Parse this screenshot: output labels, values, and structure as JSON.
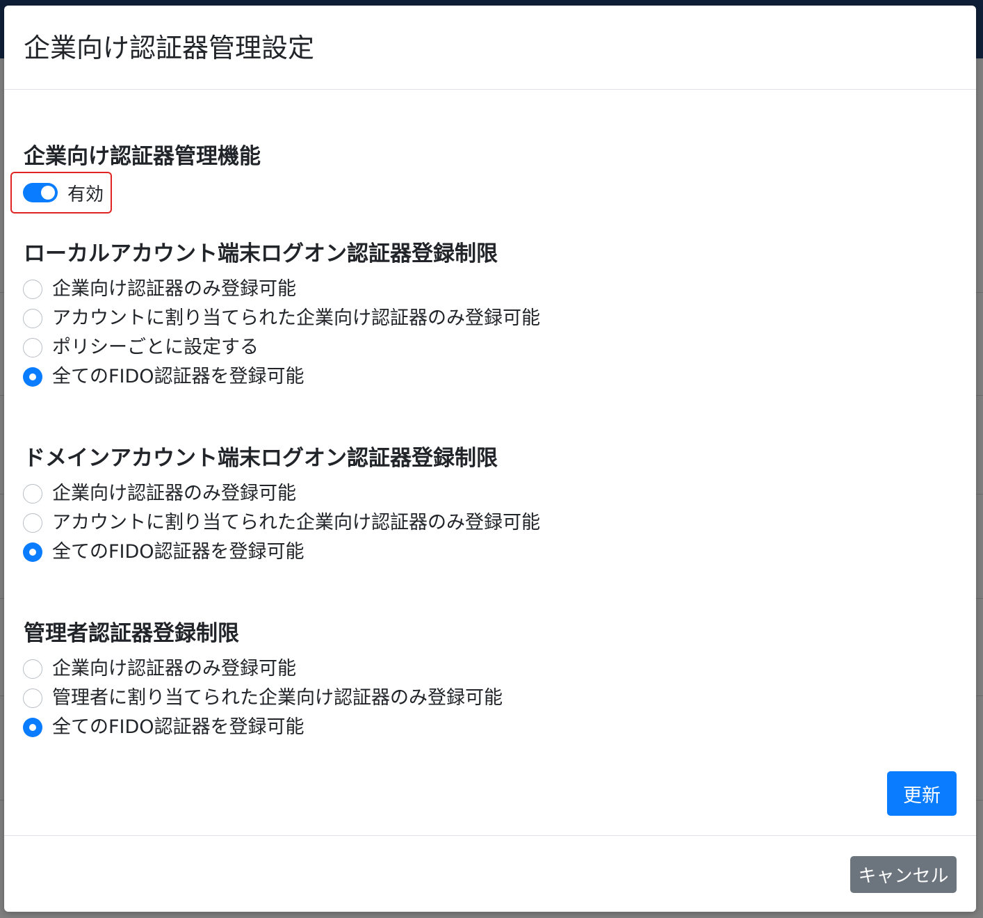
{
  "modal": {
    "title": "企業向け認証器管理設定"
  },
  "feature": {
    "heading": "企業向け認証器管理機能",
    "toggle_label": "有効",
    "toggle_on": true
  },
  "local_account": {
    "heading": "ローカルアカウント端末ログオン認証器登録制限",
    "options": [
      {
        "label": "企業向け認証器のみ登録可能",
        "checked": false
      },
      {
        "label": "アカウントに割り当てられた企業向け認証器のみ登録可能",
        "checked": false
      },
      {
        "label": "ポリシーごとに設定する",
        "checked": false
      },
      {
        "label": "全てのFIDO認証器を登録可能",
        "checked": true
      }
    ]
  },
  "domain_account": {
    "heading": "ドメインアカウント端末ログオン認証器登録制限",
    "options": [
      {
        "label": "企業向け認証器のみ登録可能",
        "checked": false
      },
      {
        "label": "アカウントに割り当てられた企業向け認証器のみ登録可能",
        "checked": false
      },
      {
        "label": "全てのFIDO認証器を登録可能",
        "checked": true
      }
    ]
  },
  "admin": {
    "heading": "管理者認証器登録制限",
    "options": [
      {
        "label": "企業向け認証器のみ登録可能",
        "checked": false
      },
      {
        "label": "管理者に割り当てられた企業向け認証器のみ登録可能",
        "checked": false
      },
      {
        "label": "全てのFIDO認証器を登録可能",
        "checked": true
      }
    ]
  },
  "buttons": {
    "update_label": "更新",
    "cancel_label": "キャンセル"
  },
  "colors": {
    "primary": "#0a7cff",
    "secondary": "#6c757d",
    "highlight_border": "#e02424"
  }
}
